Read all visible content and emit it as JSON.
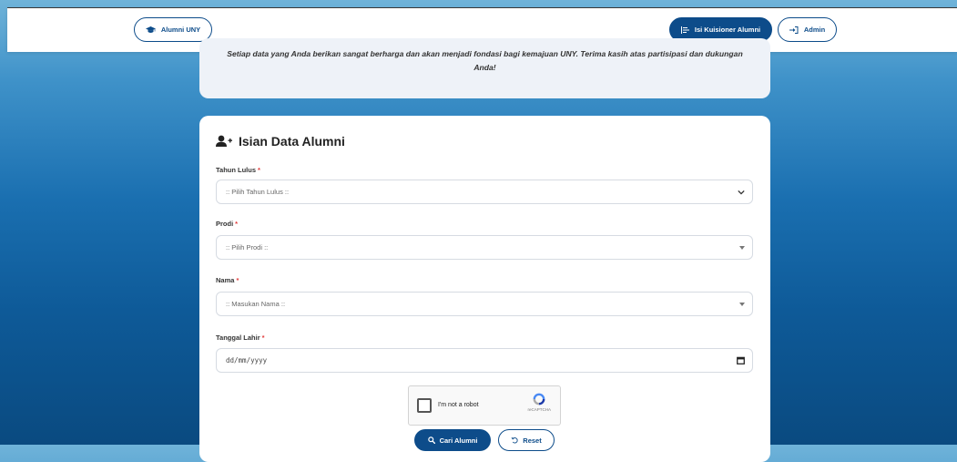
{
  "navbar": {
    "alumni_label": "Alumni UNY",
    "kuisioner_label": "Isi Kuisioner Alumni",
    "admin_label": "Admin"
  },
  "intro": {
    "text": "Setiap data yang Anda berikan sangat berharga dan akan menjadi fondasi bagi kemajuan UNY. Terima kasih atas partisipasi dan dukungan Anda!"
  },
  "form": {
    "title": "Isian Data Alumni",
    "required_mark": "*",
    "tahun_lulus": {
      "label": "Tahun Lulus",
      "value": ":: Pilih Tahun Lulus ::"
    },
    "prodi": {
      "label": "Prodi",
      "value": ":: Pilih Prodi ::"
    },
    "nama": {
      "label": "Nama",
      "value": ":: Masukan Nama ::"
    },
    "tanggal_lahir": {
      "label": "Tanggal Lahir",
      "placeholder": "dd/mm/yyyy"
    },
    "captcha": {
      "text": "I'm not a robot",
      "brand": "reCAPTCHA"
    },
    "cari_label": "Cari Alumni",
    "reset_label": "Reset"
  },
  "colors": {
    "primary": "#0d4c8a",
    "required": "#e23c3c",
    "background_top": "#6fb3d9",
    "background_bottom": "#0a4a80"
  },
  "icons": {
    "alumni": "graduation-cap-icon",
    "kuisioner": "list-icon",
    "admin": "sign-in-icon",
    "form_title": "user-plus-icon",
    "search": "search-icon",
    "reset": "undo-icon",
    "calendar": "calendar-icon",
    "chevron": "chevron-down-icon"
  }
}
